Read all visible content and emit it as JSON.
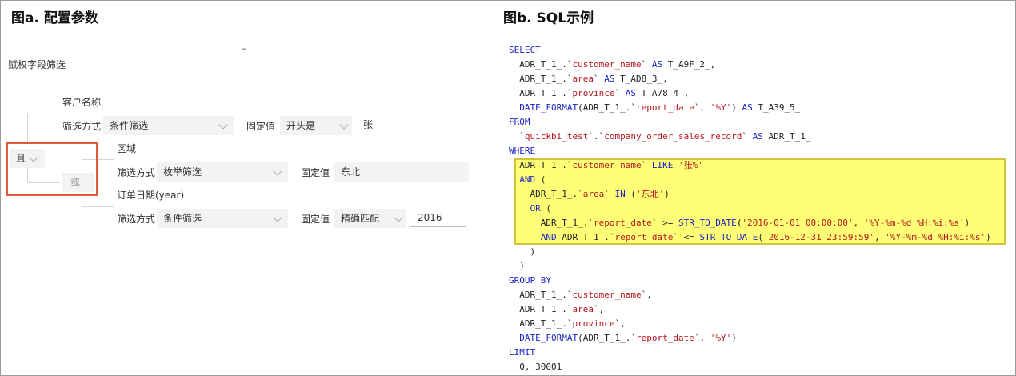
{
  "fig_a": {
    "title": "图a. 配置参数",
    "dash": "–",
    "section_label": "赋权字段筛选",
    "and_toggle": "且",
    "or_toggle": "或",
    "filters": [
      {
        "field": "客户名称",
        "method_label": "筛选方式",
        "method": "条件筛选",
        "value_label": "固定值",
        "operator": "开头是",
        "value": "张"
      },
      {
        "field": "区域",
        "method_label": "筛选方式",
        "method": "枚举筛选",
        "value_label": "固定值",
        "value": "东北"
      },
      {
        "field": "订单日期(year)",
        "method_label": "筛选方式",
        "method": "条件筛选",
        "value_label": "固定值",
        "operator": "精确匹配",
        "value": "2016"
      }
    ]
  },
  "fig_b": {
    "title": "图b. SQL示例",
    "lines": [
      "SELECT",
      "  ADR_T_1_.`customer_name` AS T_A9F_2_,",
      "  ADR_T_1_.`area` AS T_AD8_3_,",
      "  ADR_T_1_.`province` AS T_A78_4_,",
      "  DATE_FORMAT(ADR_T_1_.`report_date`, '%Y') AS T_A39_5_",
      "FROM",
      "  `quickbi_test`.`company_order_sales_record` AS ADR_T_1_",
      "WHERE",
      "  ADR_T_1_.`customer_name` LIKE '张%'",
      "  AND (",
      "    ADR_T_1_.`area` IN ('东北')",
      "    OR (",
      "      ADR_T_1_.`report_date` >= STR_TO_DATE('2016-01-01 00:00:00', '%Y-%m-%d %H:%i:%s')",
      "      AND ADR_T_1_.`report_date` <= STR_TO_DATE('2016-12-31 23:59:59', '%Y-%m-%d %H:%i:%s')",
      "    )",
      "  )",
      "GROUP BY",
      "  ADR_T_1_.`customer_name`,",
      "  ADR_T_1_.`area`,",
      "  ADR_T_1_.`province`,",
      "  DATE_FORMAT(ADR_T_1_.`report_date`, '%Y')",
      "LIMIT",
      "  0, 30001"
    ]
  },
  "colors": {
    "keyword": "#1c24c4",
    "string": "#b5171e",
    "highlight": "#ffff77",
    "red_box": "#e05a3c"
  }
}
